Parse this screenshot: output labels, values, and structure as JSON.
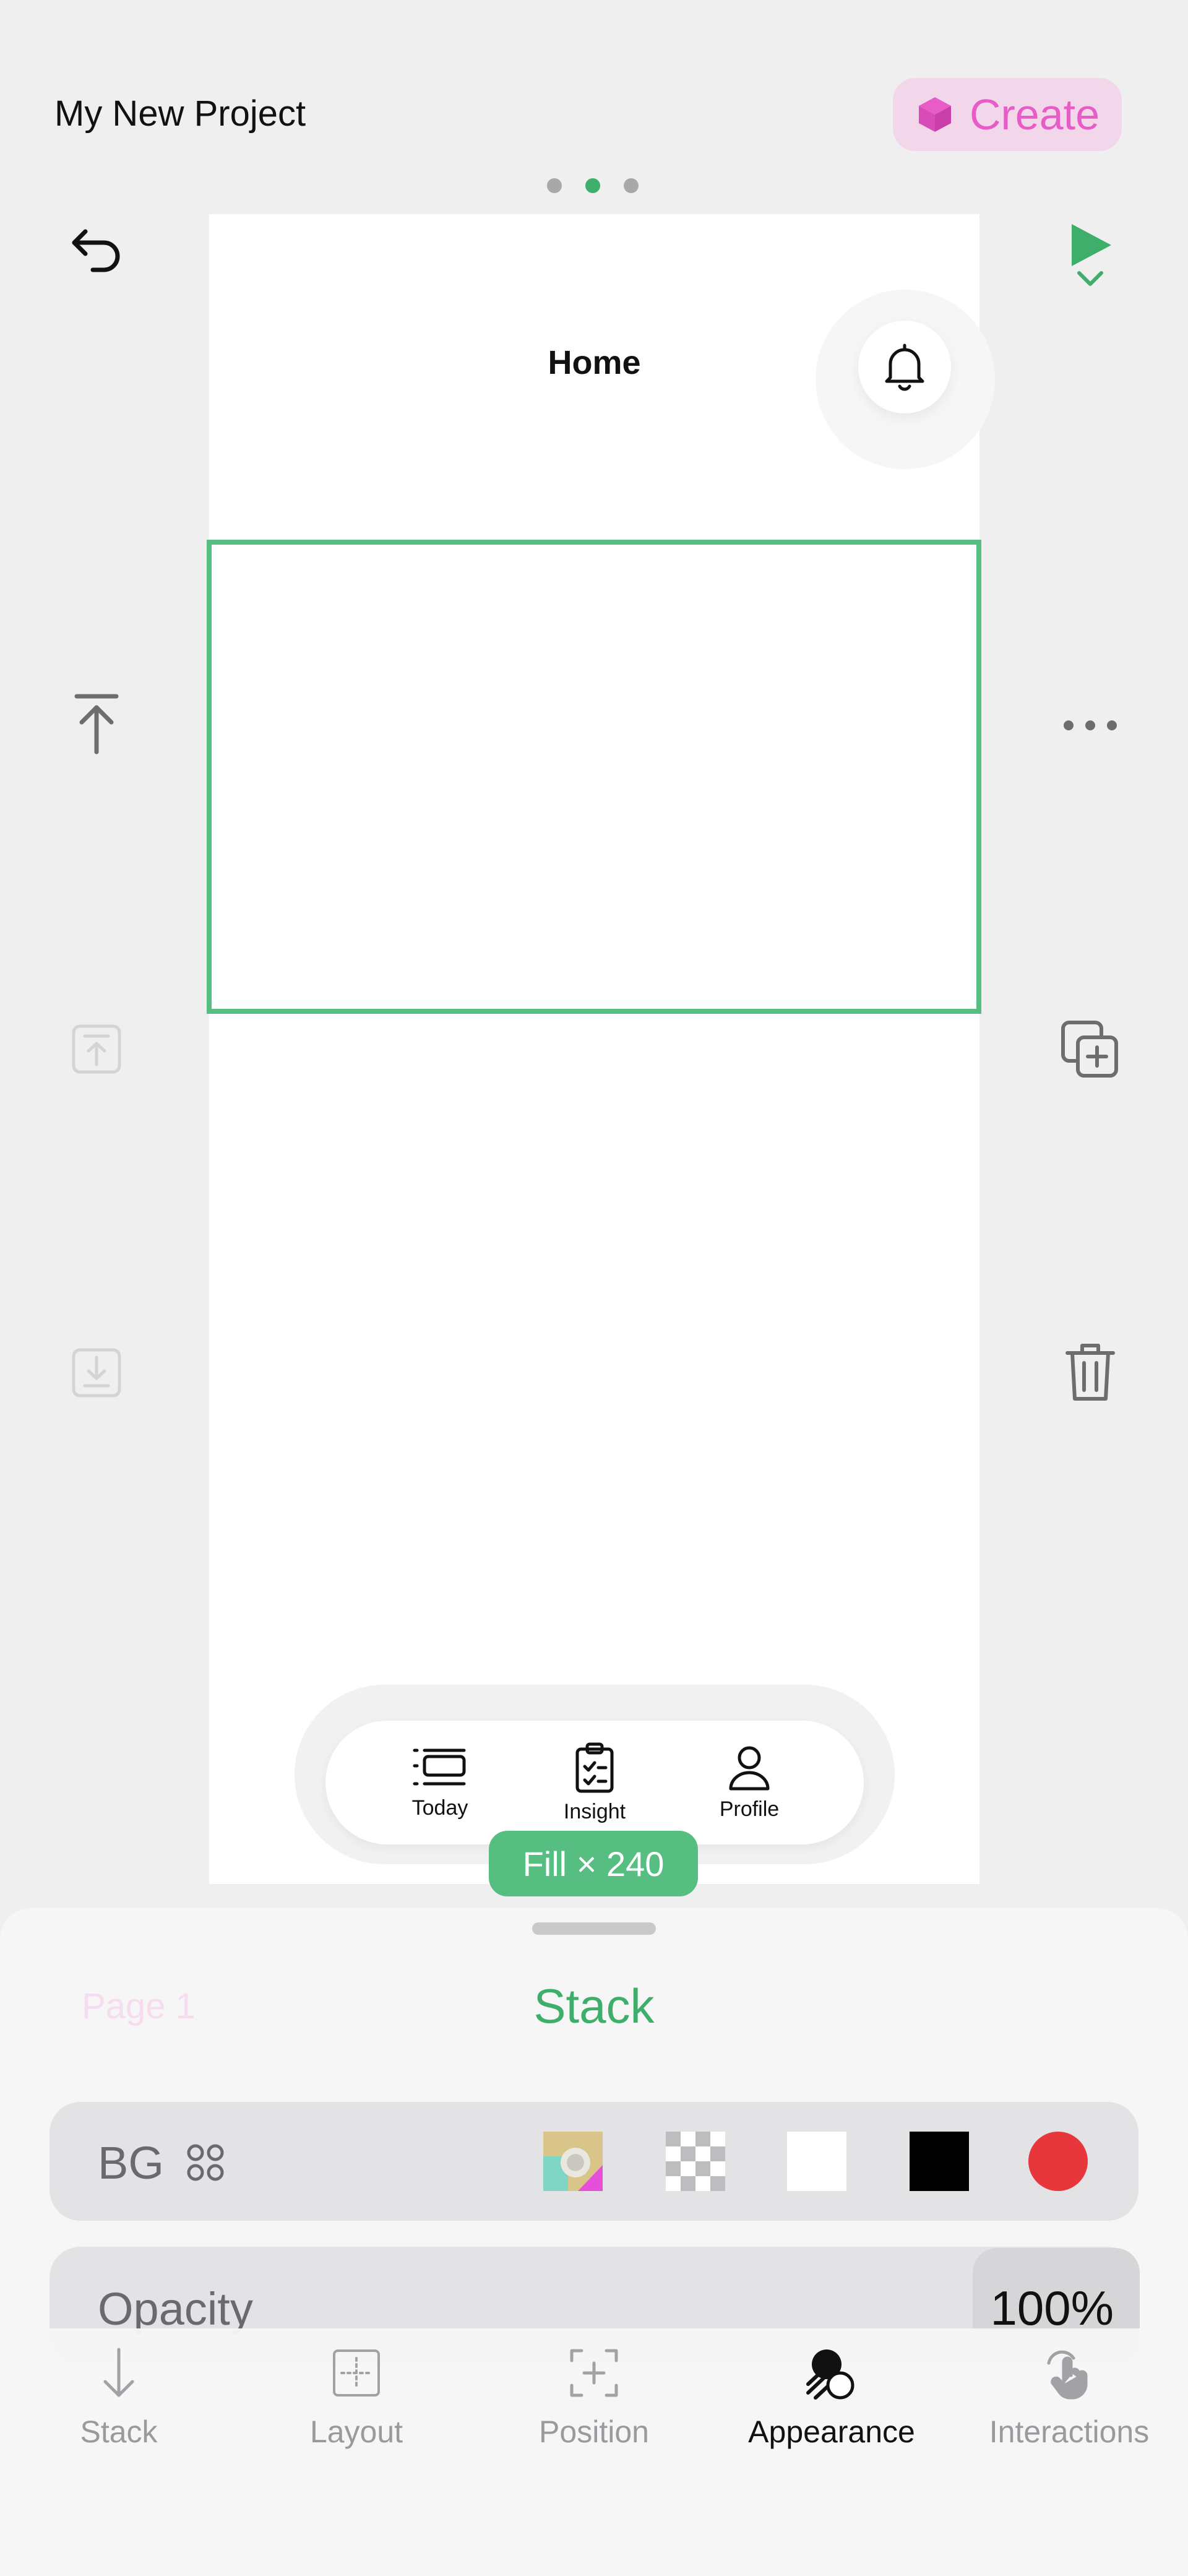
{
  "header": {
    "project_title": "My New Project",
    "create_label": "Create",
    "create_color": "#e85cc8",
    "page_dots": 3,
    "active_dot": 1
  },
  "canvas": {
    "screen_title": "Home",
    "size_badge": "Fill × 240",
    "tabs": [
      {
        "label": "Today",
        "icon": "list-icon"
      },
      {
        "label": "Insight",
        "icon": "clipboard-icon"
      },
      {
        "label": "Profile",
        "icon": "person-icon"
      }
    ]
  },
  "sheet": {
    "page_label": "Page 1",
    "title": "Stack",
    "bg": {
      "label": "BG",
      "swatches": [
        "image",
        "transparent",
        "#ffffff",
        "#000000",
        "#e8363d"
      ]
    },
    "opacity": {
      "label": "Opacity",
      "value": "100%"
    }
  },
  "modes": [
    {
      "label": "Stack",
      "icon": "arrow-down-icon"
    },
    {
      "label": "Layout",
      "icon": "layout-grid-icon"
    },
    {
      "label": "Position",
      "icon": "position-plus-icon"
    },
    {
      "label": "Appearance",
      "icon": "appearance-icon",
      "active": true
    },
    {
      "label": "Interactions",
      "icon": "hand-tap-icon"
    }
  ],
  "colors": {
    "accent": "#3fae6a",
    "selection": "#55be80",
    "create_bg": "#f2d6ea"
  }
}
